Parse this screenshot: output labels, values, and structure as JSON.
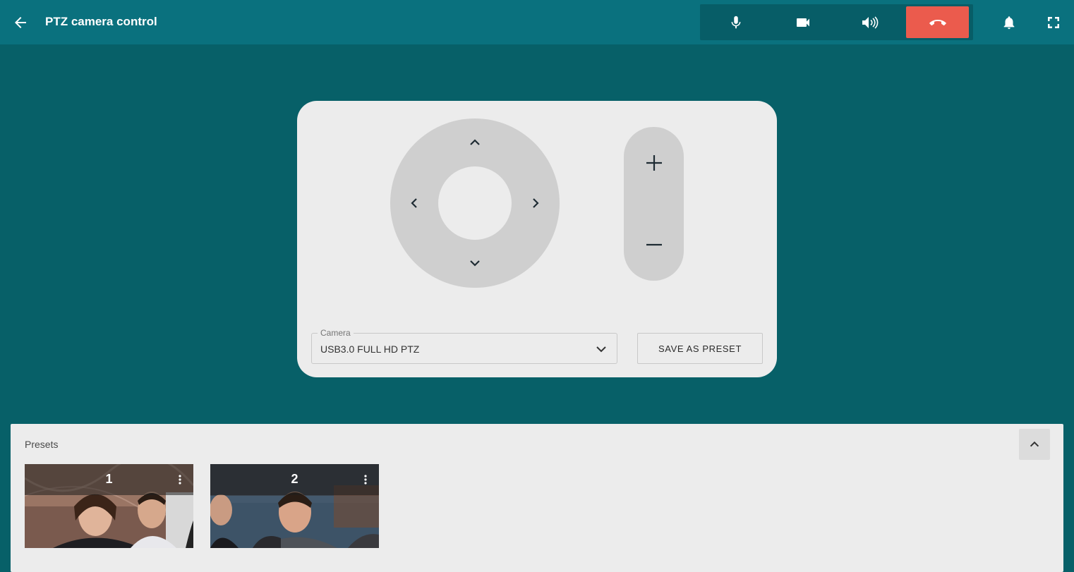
{
  "header": {
    "title": "PTZ camera control",
    "back_icon": "arrow-left-icon",
    "call_controls": [
      {
        "name": "microphone",
        "icon": "microphone-icon"
      },
      {
        "name": "camera",
        "icon": "video-camera-icon"
      },
      {
        "name": "speaker",
        "icon": "speaker-icon"
      },
      {
        "name": "hang-up",
        "icon": "phone-hangup-icon"
      }
    ],
    "notifications_icon": "bell-icon",
    "fullscreen_icon": "fullscreen-icon"
  },
  "camera_control": {
    "camera_label": "Camera",
    "camera_value": "USB3.0 FULL HD PTZ",
    "save_preset_label": "SAVE AS PRESET"
  },
  "presets": {
    "title": "Presets",
    "items": [
      {
        "number": "1"
      },
      {
        "number": "2"
      }
    ]
  },
  "colors": {
    "header_bg": "#0a717e",
    "page_bg": "#076068",
    "hangup": "#eb5b4d",
    "card_bg": "#ececec",
    "control_gray": "#cfcfcf"
  }
}
